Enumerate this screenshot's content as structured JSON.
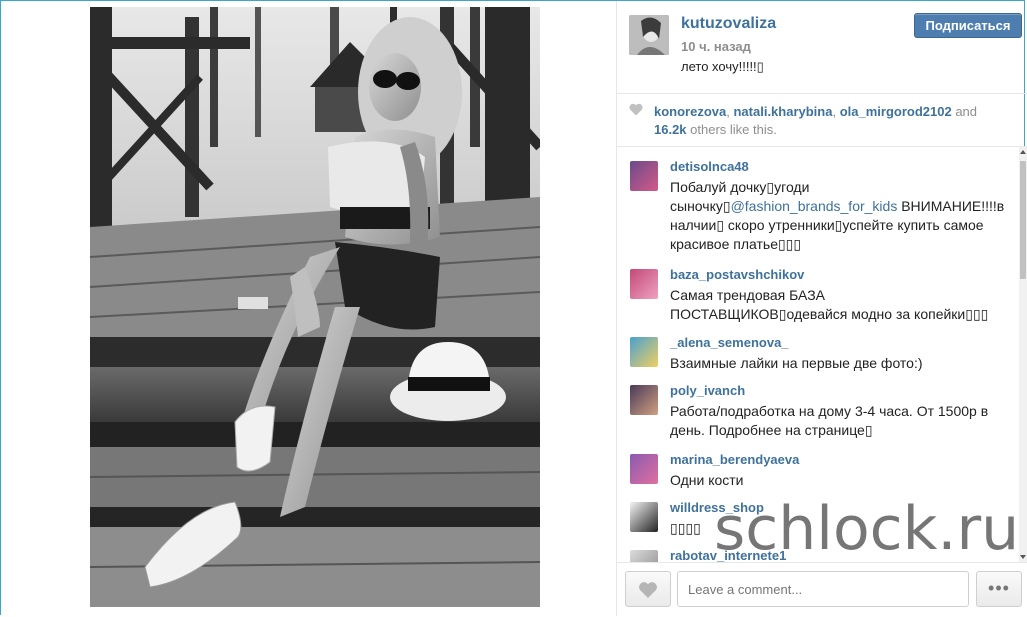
{
  "post": {
    "username": "kutuzovaliza",
    "time_ago": "10 ч. назад",
    "caption": "лето хочу!!!!!▯",
    "follow_label": "Подписаться",
    "photo_icon": "photo"
  },
  "likes": {
    "users": [
      "konorezova",
      "natali.kharybina",
      "ola_mirgorod2102"
    ],
    "separator": ", ",
    "and": " and",
    "count": "16.2k",
    "others_text": " others like this."
  },
  "comments": [
    {
      "user": "detisolnca48",
      "pre": "Побалуй дочку▯угоди сыночку▯",
      "mention": "@fashion_brands_for_kids",
      "post": " ВНИМАНИЕ!!!!в налчии▯ скоро утренники▯успейте купить самое красивое платье▯▯▯"
    },
    {
      "user": "baza_postavshchikov",
      "pre": "Самая трендовая БАЗА ПОСТАВЩИКОВ▯одевайся модно за копейки▯▯▯",
      "mention": "",
      "post": ""
    },
    {
      "user": "_alena_semenova_",
      "pre": "Взаимные лайки на первые две фото:)",
      "mention": "",
      "post": ""
    },
    {
      "user": "poly_ivanch",
      "pre": "Работа/подработка на дому 3-4 часа. От 1500р в день. Подробнее на странице▯",
      "mention": "",
      "post": ""
    },
    {
      "user": "marina_berendyaeva",
      "pre": "Одни кости",
      "mention": "",
      "post": ""
    },
    {
      "user": "willdress_shop",
      "pre": "▯▯▯▯",
      "mention": "",
      "post": ""
    },
    {
      "user": "rabotav_internete1",
      "pre": "",
      "mention": "",
      "post": ""
    }
  ],
  "footer": {
    "comment_placeholder": "Leave a comment...",
    "more_label": "•••"
  },
  "watermark": "schlock.ru",
  "colors": {
    "link": "#3f729b",
    "follow_button": "#4d7eaf",
    "muted": "#8e8e8e"
  }
}
